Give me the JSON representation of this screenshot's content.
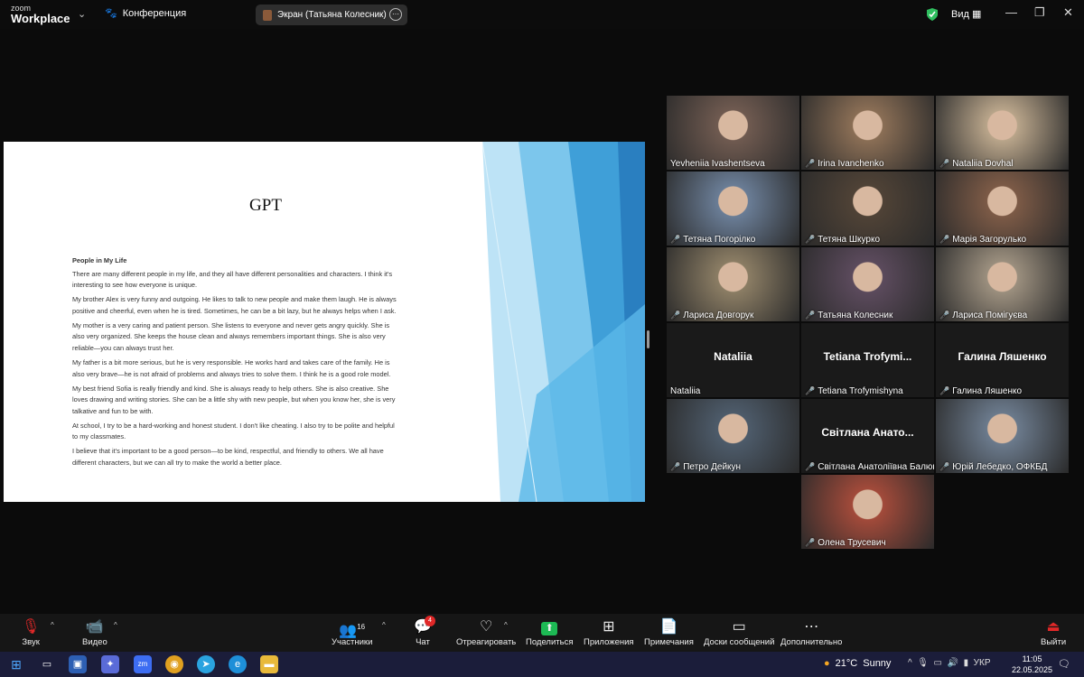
{
  "titlebar": {
    "logo_top": "zoom",
    "logo_bottom": "Workplace",
    "meeting_label": "Конференция",
    "share_label": "Экран (Татьяна Колесник)",
    "view_label": "Вид"
  },
  "slide": {
    "title": "GPT",
    "heading": "People in My Life",
    "paragraphs": [
      "There are many different people in my life, and they all have different personalities and characters. I think it's interesting to see how everyone is unique.",
      "My brother Alex is very funny and outgoing. He likes to talk to new people and make them laugh. He is always positive and cheerful, even when he is tired. Sometimes, he can be a bit lazy, but he always helps when I ask.",
      "My mother is a very caring and patient person. She listens to everyone and never gets angry quickly. She is also very organized. She keeps the house clean and always remembers important things. She is also very reliable—you can always trust her.",
      "My father is a bit more serious, but he is very responsible. He works hard and takes care of the family. He is also very brave—he is not afraid of problems and always tries to solve them. I think he is a good role model.",
      "My best friend Sofia is really friendly and kind. She is always ready to help others. She is also creative. She loves drawing and writing stories. She can be a little shy with new people, but when you know her, she is very talkative and fun to be with.",
      "At school, I try to be a hard-working and honest student. I don't like cheating. I also try to be polite and helpful to my classmates.",
      "I believe that it's important to be a good person—to be kind, respectful, and friendly to others. We all have different characters, but we can all try to make the world a better place."
    ]
  },
  "participants": [
    {
      "name": "Yevheniia Ivashentseva",
      "muted": false,
      "video": true,
      "bg": "#6f5a50"
    },
    {
      "name": "Irina Ivanchenko",
      "muted": true,
      "video": true,
      "bg": "#8a6e55"
    },
    {
      "name": "Nataliia Dovhal",
      "muted": true,
      "video": true,
      "bg": "#b9a58a"
    },
    {
      "name": "Тетяна Погорілко",
      "muted": true,
      "video": true,
      "bg": "#6a7d96"
    },
    {
      "name": "Тетяна Шкурко",
      "muted": true,
      "video": true,
      "bg": "#4f4236"
    },
    {
      "name": "Марія Загорулько",
      "muted": true,
      "video": true,
      "bg": "#7c5a46"
    },
    {
      "name": "Лариса Довгорук",
      "muted": true,
      "video": true,
      "bg": "#8b7d64"
    },
    {
      "name": "Татьяна Колесник",
      "muted": true,
      "video": true,
      "bg": "#5b4a5c",
      "active": true
    },
    {
      "name": "Лариса Помігуєва",
      "muted": true,
      "video": true,
      "bg": "#9b8f7e"
    },
    {
      "name": "Nataliia",
      "muted": false,
      "video": false,
      "display": "Nataliia"
    },
    {
      "name": "Tetiana Trofymishyna",
      "muted": true,
      "video": false,
      "display": "Tetiana Trofymi..."
    },
    {
      "name": "Галина Ляшенко",
      "muted": true,
      "video": false,
      "display": "Галина Ляшенко"
    },
    {
      "name": "Петро Дейкун",
      "muted": true,
      "video": true,
      "bg": "#4d5b6a"
    },
    {
      "name": "Світлана Анатоліївна Балюн...",
      "muted": true,
      "video": false,
      "display": "Світлана Анато..."
    },
    {
      "name": "Юрій Лебедко, ОФКБД",
      "muted": true,
      "video": true,
      "bg": "#6b7a8c"
    },
    {
      "name": "Олена Трусевич",
      "muted": true,
      "video": true,
      "bg": "#a24a3a"
    }
  ],
  "toolbar": {
    "audio": "Звук",
    "video": "Видео",
    "participants": "Участники",
    "participants_count": "16",
    "chat": "Чат",
    "chat_badge": "4",
    "react": "Отреагировать",
    "share": "Поделиться",
    "apps": "Приложения",
    "notes": "Примечания",
    "whiteboards": "Доски сообщений",
    "more": "Дополнительно",
    "leave": "Выйти"
  },
  "taskbar": {
    "temperature": "21°C",
    "weather": "Sunny",
    "lang": "УКР",
    "time": "11:05",
    "date": "22.05.2025"
  }
}
